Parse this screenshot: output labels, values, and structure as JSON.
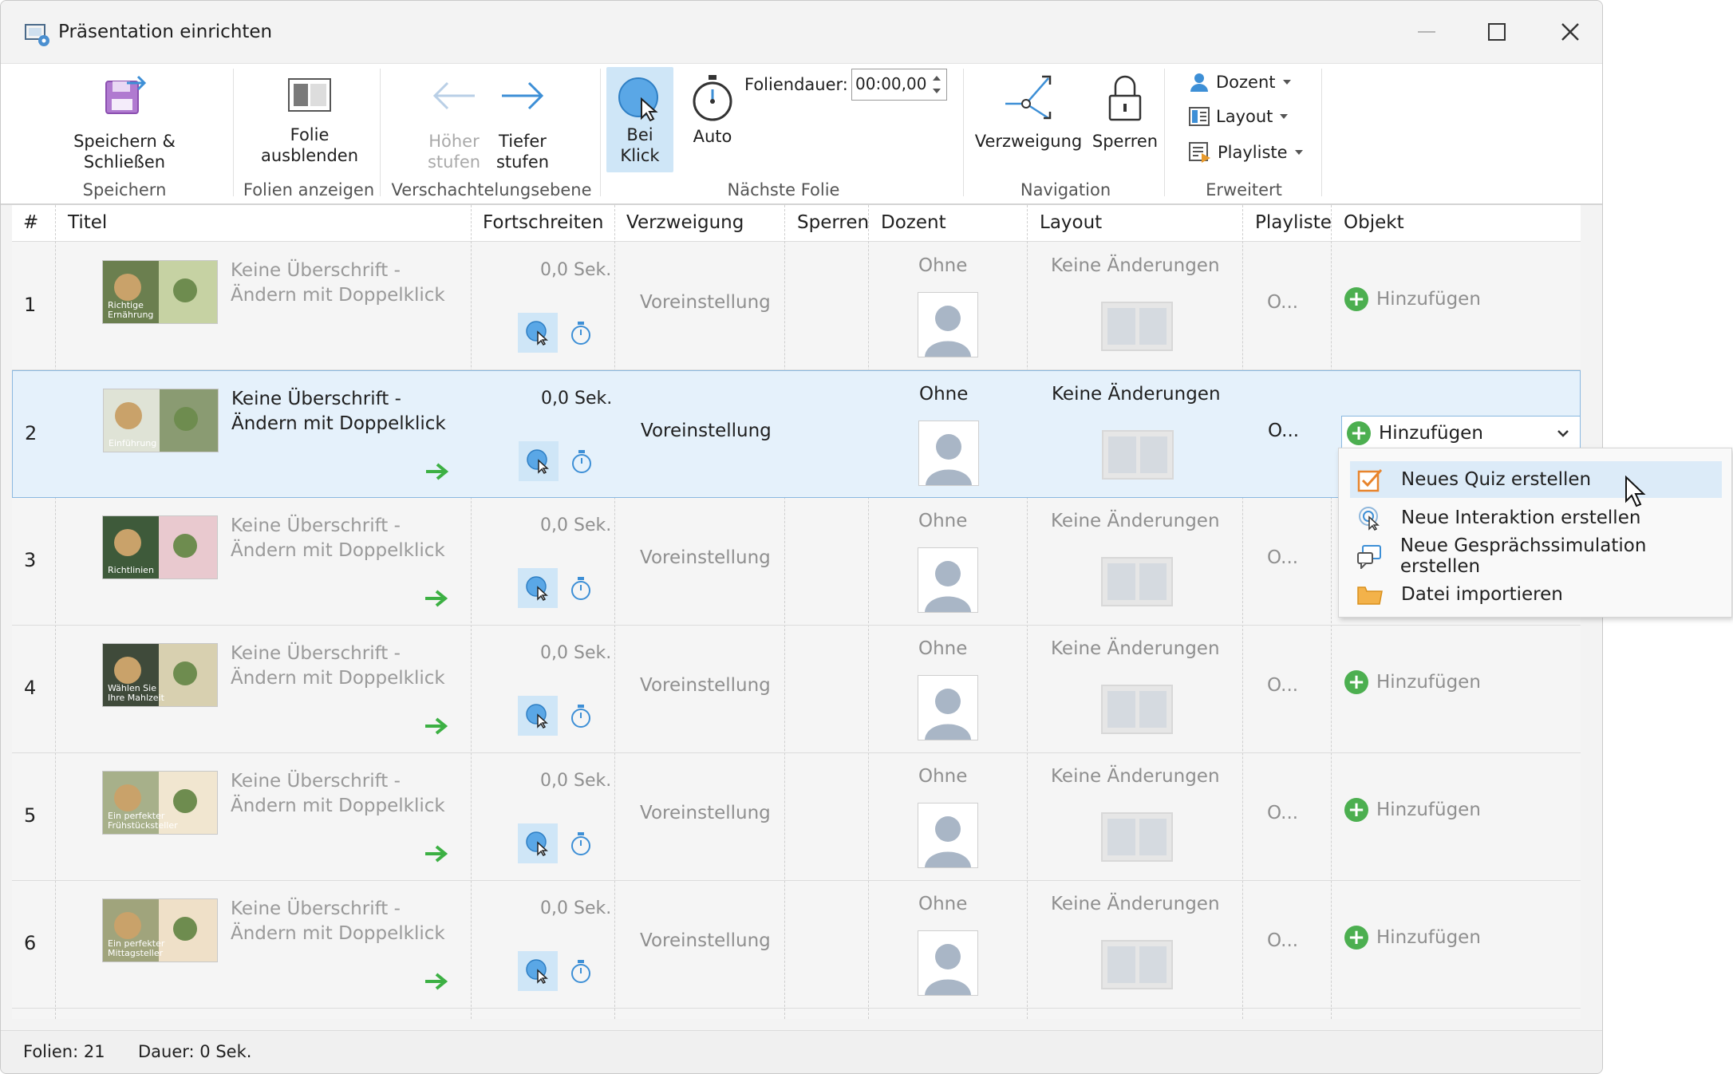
{
  "window": {
    "title": "Präsentation einrichten"
  },
  "ribbon": {
    "speichern": {
      "button": "Speichern & Schließen",
      "group": "Speichern"
    },
    "folien": {
      "button_line1": "Folie",
      "button_line2": "ausblenden",
      "group": "Folien anzeigen"
    },
    "ebene": {
      "hoeher_line1": "Höher",
      "hoeher_line2": "stufen",
      "tiefer_line1": "Tiefer",
      "tiefer_line2": "stufen",
      "group": "Verschachtelungsebene"
    },
    "naechste": {
      "klick_line1": "Bei",
      "klick_line2": "Klick",
      "auto": "Auto",
      "foliendauer_label": "Foliendauer:",
      "foliendauer_value": "00:00,00",
      "group": "Nächste Folie"
    },
    "navigation": {
      "verzweigung": "Verzweigung",
      "sperren": "Sperren",
      "group": "Navigation"
    },
    "erweitert": {
      "dozent": "Dozent",
      "layout": "Layout",
      "playliste": "Playliste",
      "group": "Erweitert"
    }
  },
  "columns": [
    "#",
    "Titel",
    "Fortschreiten",
    "Verzweigung",
    "Sperren",
    "Dozent",
    "Layout",
    "Playliste",
    "Objekt"
  ],
  "rows": [
    {
      "num": "1",
      "title": "Keine Überschrift - Ändern mit Doppelklick",
      "advance": "0,0 Sek.",
      "branch": "Voreinstellung",
      "dozent": "Ohne",
      "layout": "Keine Änderungen",
      "playlist": "O...",
      "object": "Hinzufügen",
      "thumb_text": "Richtige Ernährung"
    },
    {
      "num": "2",
      "title": "Keine Überschrift - Ändern mit Doppelklick",
      "advance": "0,0 Sek.",
      "branch": "Voreinstellung",
      "dozent": "Ohne",
      "layout": "Keine Änderungen",
      "playlist": "O...",
      "object": "Hinzufügen",
      "thumb_text": "Einführung"
    },
    {
      "num": "3",
      "title": "Keine Überschrift - Ändern mit Doppelklick",
      "advance": "0,0 Sek.",
      "branch": "Voreinstellung",
      "dozent": "Ohne",
      "layout": "Keine Änderungen",
      "playlist": "O...",
      "object": "",
      "thumb_text": "Richtlinien"
    },
    {
      "num": "4",
      "title": "Keine Überschrift - Ändern mit Doppelklick",
      "advance": "0,0 Sek.",
      "branch": "Voreinstellung",
      "dozent": "Ohne",
      "layout": "Keine Änderungen",
      "playlist": "O...",
      "object": "Hinzufügen",
      "thumb_text": "Wählen Sie Ihre Mahlzeit"
    },
    {
      "num": "5",
      "title": "Keine Überschrift - Ändern mit Doppelklick",
      "advance": "0,0 Sek.",
      "branch": "Voreinstellung",
      "dozent": "Ohne",
      "layout": "Keine Änderungen",
      "playlist": "O...",
      "object": "Hinzufügen",
      "thumb_text": "Ein perfekter Frühstücksteller"
    },
    {
      "num": "6",
      "title": "Keine Überschrift - Ändern mit Doppelklick",
      "advance": "0,0 Sek.",
      "branch": "Voreinstellung",
      "dozent": "Ohne",
      "layout": "Keine Änderungen",
      "playlist": "O...",
      "object": "Hinzufügen",
      "thumb_text": "Ein perfekter Mittagsteller"
    }
  ],
  "menu": {
    "items": [
      "Neues Quiz erstellen",
      "Neue Interaktion erstellen",
      "Neue Gesprächssimulation erstellen",
      "Datei importieren"
    ]
  },
  "status": {
    "folien": "Folien: 21",
    "dauer": "Dauer:  0 Sek."
  },
  "colors": {
    "accent": "#cfe6f7",
    "add_green": "#4caf50",
    "arrow_green": "#3cb043",
    "selection_border": "#8ab8e0"
  }
}
